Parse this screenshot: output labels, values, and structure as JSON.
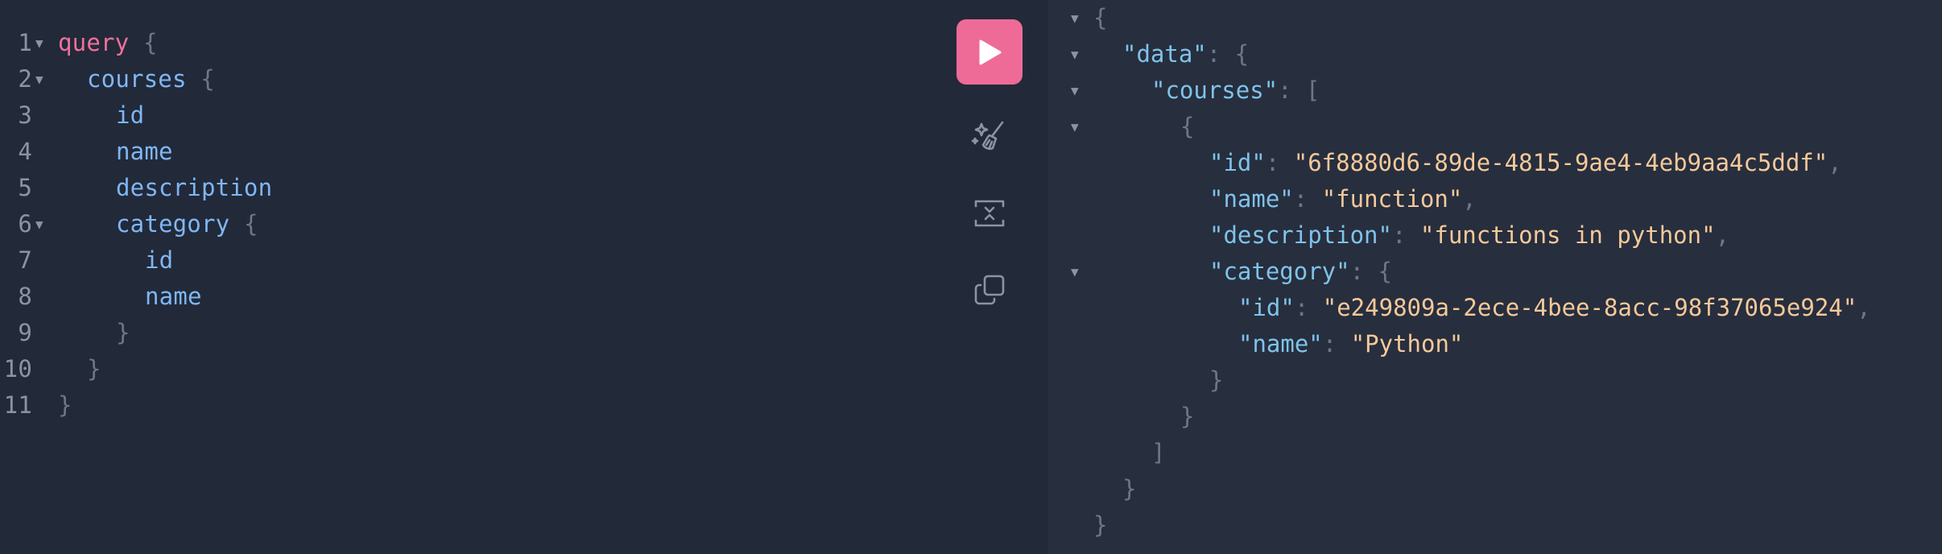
{
  "editor": {
    "lines": [
      {
        "num": "1",
        "fold": true,
        "indent": 0,
        "tokens": [
          {
            "t": "query",
            "c": "kw"
          },
          {
            "t": " {",
            "c": "punct"
          }
        ]
      },
      {
        "num": "2",
        "fold": true,
        "indent": 1,
        "tokens": [
          {
            "t": "courses",
            "c": "field"
          },
          {
            "t": " {",
            "c": "punct"
          }
        ]
      },
      {
        "num": "3",
        "fold": false,
        "indent": 2,
        "tokens": [
          {
            "t": "id",
            "c": "field"
          }
        ]
      },
      {
        "num": "4",
        "fold": false,
        "indent": 2,
        "tokens": [
          {
            "t": "name",
            "c": "field"
          }
        ]
      },
      {
        "num": "5",
        "fold": false,
        "indent": 2,
        "tokens": [
          {
            "t": "description",
            "c": "field"
          }
        ]
      },
      {
        "num": "6",
        "fold": true,
        "indent": 2,
        "tokens": [
          {
            "t": "category",
            "c": "field"
          },
          {
            "t": " {",
            "c": "punct"
          }
        ]
      },
      {
        "num": "7",
        "fold": false,
        "indent": 3,
        "tokens": [
          {
            "t": "id",
            "c": "field"
          }
        ]
      },
      {
        "num": "8",
        "fold": false,
        "indent": 3,
        "tokens": [
          {
            "t": "name",
            "c": "field"
          }
        ]
      },
      {
        "num": "9",
        "fold": false,
        "indent": 2,
        "tokens": [
          {
            "t": "}",
            "c": "punct"
          }
        ]
      },
      {
        "num": "10",
        "fold": false,
        "indent": 1,
        "tokens": [
          {
            "t": "}",
            "c": "punct"
          }
        ]
      },
      {
        "num": "11",
        "fold": false,
        "indent": 0,
        "tokens": [
          {
            "t": "}",
            "c": "punct"
          }
        ]
      }
    ]
  },
  "toolbar": {
    "run_icon": "play-icon",
    "prettify_icon": "magic-wand-icon",
    "merge_icon": "merge-fragments-icon",
    "copy_icon": "copy-icon"
  },
  "result": {
    "lines": [
      {
        "fold": true,
        "indent": 0,
        "tokens": [
          {
            "t": "{",
            "c": "punct"
          }
        ]
      },
      {
        "fold": true,
        "indent": 1,
        "tokens": [
          {
            "t": "\"data\"",
            "c": "rkey"
          },
          {
            "t": ": {",
            "c": "punct"
          }
        ]
      },
      {
        "fold": true,
        "indent": 2,
        "tokens": [
          {
            "t": "\"courses\"",
            "c": "rkey"
          },
          {
            "t": ": [",
            "c": "punct"
          }
        ]
      },
      {
        "fold": true,
        "indent": 3,
        "tokens": [
          {
            "t": "{",
            "c": "punct"
          }
        ]
      },
      {
        "fold": false,
        "indent": 4,
        "tokens": [
          {
            "t": "\"id\"",
            "c": "rkey"
          },
          {
            "t": ": ",
            "c": "punct"
          },
          {
            "t": "\"6f8880d6-89de-4815-9ae4-4eb9aa4c5ddf\"",
            "c": "rstr"
          },
          {
            "t": ",",
            "c": "punct"
          }
        ]
      },
      {
        "fold": false,
        "indent": 4,
        "tokens": [
          {
            "t": "\"name\"",
            "c": "rkey"
          },
          {
            "t": ": ",
            "c": "punct"
          },
          {
            "t": "\"function\"",
            "c": "rstr"
          },
          {
            "t": ",",
            "c": "punct"
          }
        ]
      },
      {
        "fold": false,
        "indent": 4,
        "tokens": [
          {
            "t": "\"description\"",
            "c": "rkey"
          },
          {
            "t": ": ",
            "c": "punct"
          },
          {
            "t": "\"functions in python\"",
            "c": "rstr"
          },
          {
            "t": ",",
            "c": "punct"
          }
        ]
      },
      {
        "fold": true,
        "indent": 4,
        "tokens": [
          {
            "t": "\"category\"",
            "c": "rkey"
          },
          {
            "t": ": {",
            "c": "punct"
          }
        ]
      },
      {
        "fold": false,
        "indent": 5,
        "tokens": [
          {
            "t": "\"id\"",
            "c": "rkey"
          },
          {
            "t": ": ",
            "c": "punct"
          },
          {
            "t": "\"e249809a-2ece-4bee-8acc-98f37065e924\"",
            "c": "rstr"
          },
          {
            "t": ",",
            "c": "punct"
          }
        ]
      },
      {
        "fold": false,
        "indent": 5,
        "tokens": [
          {
            "t": "\"name\"",
            "c": "rkey"
          },
          {
            "t": ": ",
            "c": "punct"
          },
          {
            "t": "\"Python\"",
            "c": "rstr"
          }
        ]
      },
      {
        "fold": false,
        "indent": 4,
        "tokens": [
          {
            "t": "}",
            "c": "punct"
          }
        ]
      },
      {
        "fold": false,
        "indent": 3,
        "tokens": [
          {
            "t": "}",
            "c": "punct"
          }
        ]
      },
      {
        "fold": false,
        "indent": 2,
        "tokens": [
          {
            "t": "]",
            "c": "punct"
          }
        ]
      },
      {
        "fold": false,
        "indent": 1,
        "tokens": [
          {
            "t": "}",
            "c": "punct"
          }
        ]
      },
      {
        "fold": false,
        "indent": 0,
        "tokens": [
          {
            "t": "}",
            "c": "punct"
          }
        ]
      }
    ]
  },
  "colors": {
    "run_button": "#ee6b98",
    "keyword": "#f0719c",
    "field": "#7fb7f5",
    "result_key": "#7fc3ea",
    "result_string": "#f5c99a"
  }
}
